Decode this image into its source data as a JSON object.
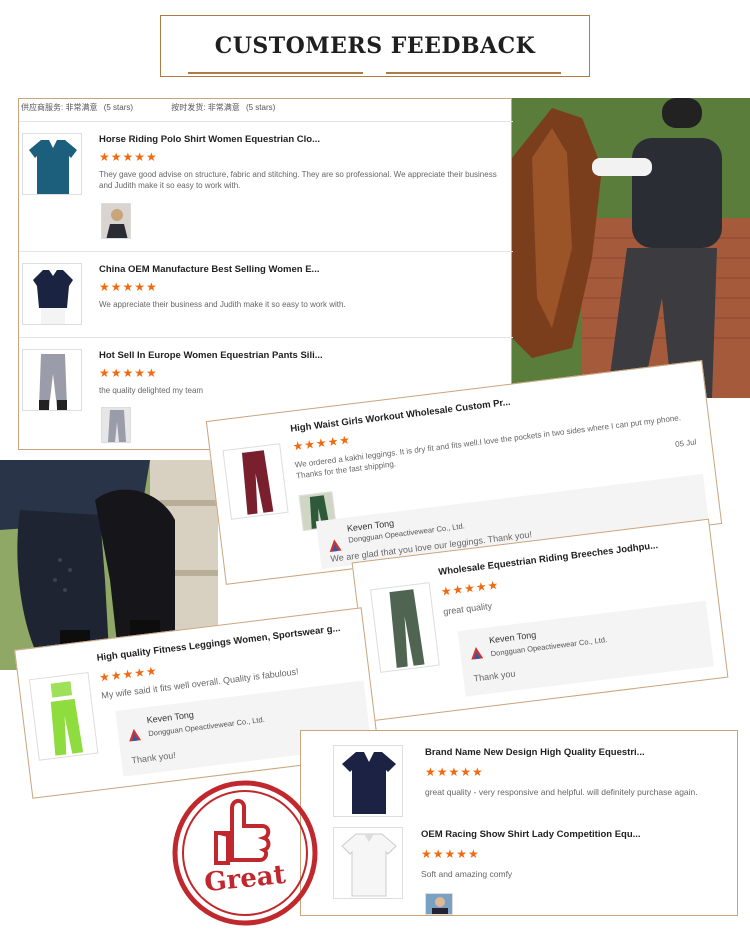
{
  "header": {
    "title": "CUSTOMERS FEEDBACK"
  },
  "card1": {
    "rating_supplier": "供应商服务: 非常满意",
    "rating_supplier_stars": "(5 stars)",
    "rating_delivery": "按时发货: 非常满意",
    "rating_delivery_stars": "(5 stars)",
    "items": [
      {
        "title": "Horse Riding Polo Shirt Women Equestrian Clo...",
        "stars": "★★★★★",
        "text": "They gave good advise on structure, fabric and stitching. They are so professional.  We appreciate their business and Judith make it so easy to work with."
      },
      {
        "title": "China OEM Manufacture Best Selling Women E...",
        "stars": "★★★★★",
        "text": "We appreciate their business and Judith make it so easy to work with."
      },
      {
        "title": "Hot Sell In Europe Women Equestrian Pants Sili...",
        "stars": "★★★★★",
        "text": "the quality delighted my team"
      }
    ]
  },
  "card2": {
    "title": "High Waist Girls Workout Wholesale Custom Pr...",
    "stars": "★★★★★",
    "text": "We ordered a kakhi leggings. It is dry fit and fits well.I love the pockets in two sides where I can put my phone. Thanks for the fast shipping.",
    "date": "05 Jul",
    "reply_name": "Keven Tong",
    "reply_company": "Dongguan Opeactivewear Co., Ltd.",
    "reply_text": "We are glad that you love our leggings.  Thank you!"
  },
  "card3": {
    "title": "Wholesale Equestrian Riding Breeches Jodhpu...",
    "stars": "★★★★★",
    "text": "great quality",
    "reply_name": "Keven Tong",
    "reply_company": "Dongguan Opeactivewear Co., Ltd.",
    "reply_text": "Thank you"
  },
  "card4": {
    "title": "High quality Fitness Leggings Women, Sportswear g...",
    "stars": "★★★★★",
    "text": "My wife said it fits well overall. Quality is fabulous!",
    "reply_name": "Keven Tong",
    "reply_company": "Dongguan Opeactivewear Co., Ltd.",
    "reply_text": "Thank you!"
  },
  "card5": {
    "items": [
      {
        "title": "Brand Name New Design High Quality Equestri...",
        "stars": "★★★★★",
        "text": "great quality - very responsive and helpful.  will definitely purchase again."
      },
      {
        "title": "OEM Racing Show Shirt Lady Competition Equ...",
        "stars": "★★★★★",
        "text": "Soft and amazing comfy"
      }
    ]
  },
  "stamp": {
    "text": "Great"
  },
  "colors": {
    "accent": "#f26a10",
    "border": "#b07a45",
    "stamp": "#c0282d"
  }
}
